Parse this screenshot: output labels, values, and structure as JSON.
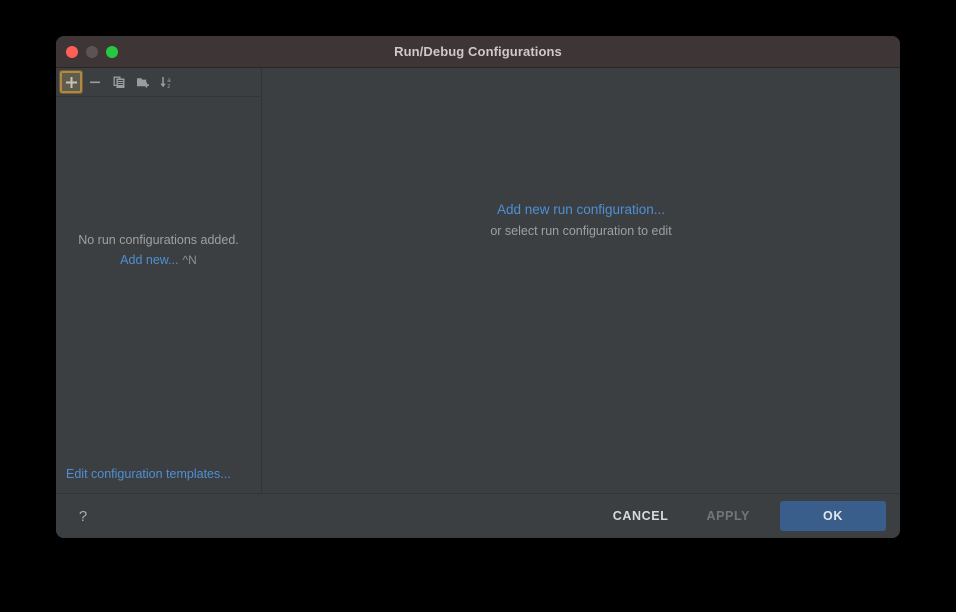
{
  "window": {
    "title": "Run/Debug Configurations",
    "traffic_lights": [
      {
        "name": "close",
        "color": "#ff5f57"
      },
      {
        "name": "minimize",
        "color": "#5b5354"
      },
      {
        "name": "zoom",
        "color": "#28c840"
      }
    ]
  },
  "toolbar": {
    "buttons": [
      {
        "icon": "plus-icon",
        "label": "Add New Configuration",
        "focused": true
      },
      {
        "icon": "minus-icon",
        "label": "Remove Configuration",
        "focused": false
      },
      {
        "icon": "copy-icon",
        "label": "Copy Configuration",
        "focused": false
      },
      {
        "icon": "folder-add-icon",
        "label": "Create New Folder",
        "focused": false
      },
      {
        "icon": "sort-alpha-icon",
        "label": "Sort Configurations",
        "focused": false
      }
    ]
  },
  "left_panel": {
    "empty_message": "No run configurations added.",
    "add_new_link": "Add new...",
    "add_new_shortcut": "^N",
    "edit_templates_link": "Edit configuration templates..."
  },
  "right_panel": {
    "add_link": "Add new run configuration...",
    "hint": "or select run configuration to edit"
  },
  "footer": {
    "help_label": "?",
    "cancel_label": "CANCEL",
    "apply_label": "APPLY",
    "apply_enabled": false,
    "ok_label": "OK"
  },
  "colors": {
    "window_background": "#3c3f41",
    "title_bar": "#3d3536",
    "link_blue": "#4e8fd4",
    "primary_button": "#3a5e8c",
    "focus_ring": "#b5883f",
    "muted_text": "#9ea0a1"
  }
}
